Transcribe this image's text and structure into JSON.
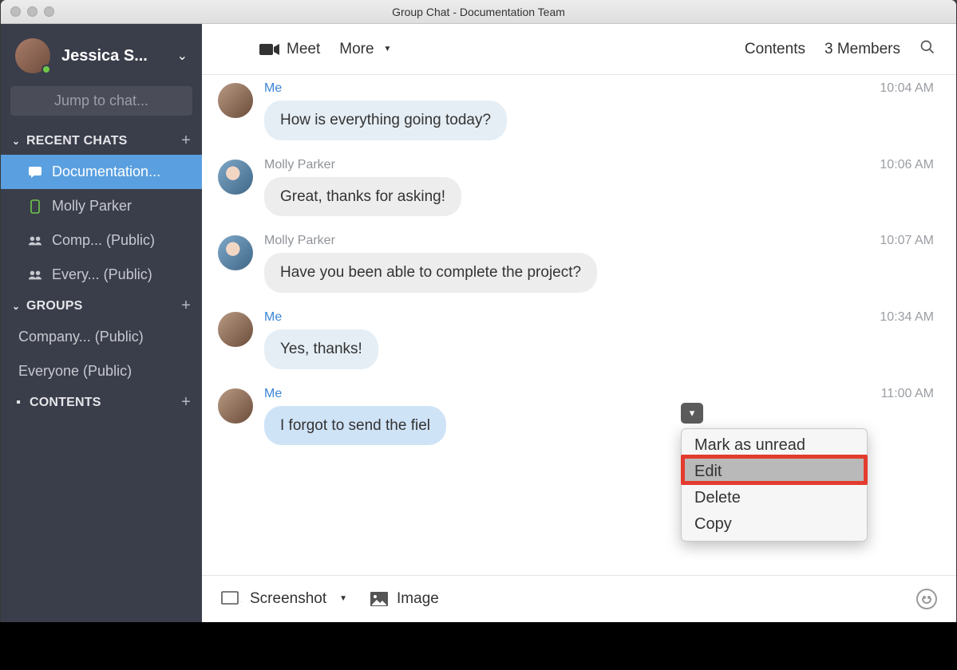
{
  "window": {
    "title": "Group Chat - Documentation Team"
  },
  "profile": {
    "name": "Jessica S..."
  },
  "jump_placeholder": "Jump to chat...",
  "sections": {
    "recent": {
      "label": "RECENT CHATS"
    },
    "groups": {
      "label": "GROUPS"
    },
    "contents": {
      "label": "CONTENTS"
    }
  },
  "recent_chats": [
    {
      "label": "Documentation...",
      "icon": "chat",
      "active": true
    },
    {
      "label": "Molly Parker",
      "icon": "phone"
    },
    {
      "label": "Comp... (Public)",
      "icon": "people"
    },
    {
      "label": "Every... (Public)",
      "icon": "people"
    }
  ],
  "groups": [
    {
      "label": "Company... (Public)"
    },
    {
      "label": "Everyone (Public)"
    }
  ],
  "toolbar": {
    "meet": "Meet",
    "more": "More",
    "contents": "Contents",
    "members": "3 Members"
  },
  "messages": [
    {
      "sender": "Me",
      "me": true,
      "time": "10:04 AM",
      "text": "How is everything going today?"
    },
    {
      "sender": "Molly Parker",
      "me": false,
      "time": "10:06 AM",
      "text": "Great, thanks for asking!"
    },
    {
      "sender": "Molly Parker",
      "me": false,
      "time": "10:07 AM",
      "text": "Have you been able to complete the project?"
    },
    {
      "sender": "Me",
      "me": true,
      "time": "10:34 AM",
      "text": "Yes, thanks!"
    },
    {
      "sender": "Me",
      "me": true,
      "time": "11:00 AM",
      "text": "I forgot to send the fiel",
      "selected": true
    }
  ],
  "context_menu": {
    "items": [
      "Mark as unread",
      "Edit",
      "Delete",
      "Copy"
    ],
    "hover_index": 1,
    "highlight_index": 1
  },
  "composer": {
    "screenshot": "Screenshot",
    "image": "Image"
  }
}
